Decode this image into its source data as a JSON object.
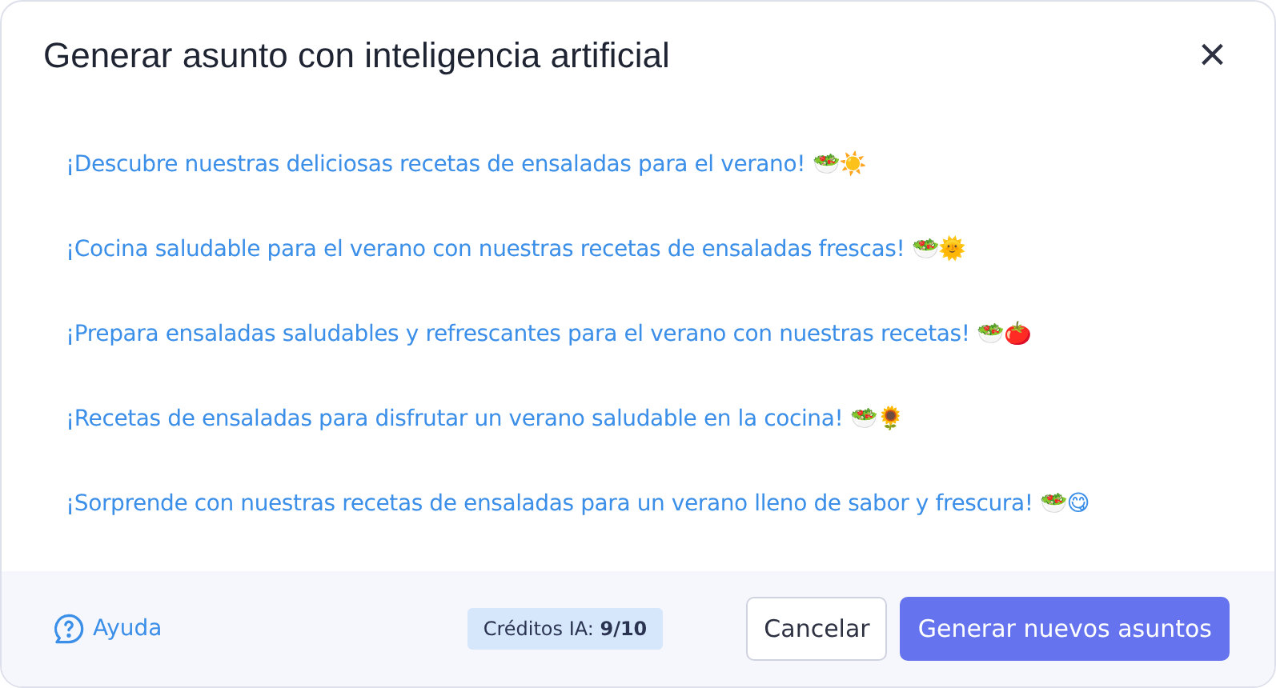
{
  "dialog": {
    "title": "Generar asunto con inteligencia artificial",
    "close": "×"
  },
  "suggestions": [
    {
      "text": "¡Descubre nuestras deliciosas recetas de ensaladas para el verano! 🥗☀️"
    },
    {
      "text": "¡Cocina saludable para el verano con nuestras recetas de ensaladas frescas! 🥗🌞"
    },
    {
      "text": "¡Prepara ensaladas saludables y refrescantes para el verano con nuestras recetas! 🥗🍅"
    },
    {
      "text": "¡Recetas de ensaladas para disfrutar un verano saludable en la cocina! 🥗🌻"
    },
    {
      "text": "¡Sorprende con nuestras recetas de ensaladas para un verano lleno de sabor y frescura! 🥗😋"
    }
  ],
  "footer": {
    "help": "Ayuda",
    "credits": "Créditos IA: **9/10**",
    "buttons": [
      {
        "label": "Cancelar",
        "kind": "secondary"
      },
      {
        "label": "Generar nuevos asuntos",
        "kind": "primary"
      }
    ]
  }
}
